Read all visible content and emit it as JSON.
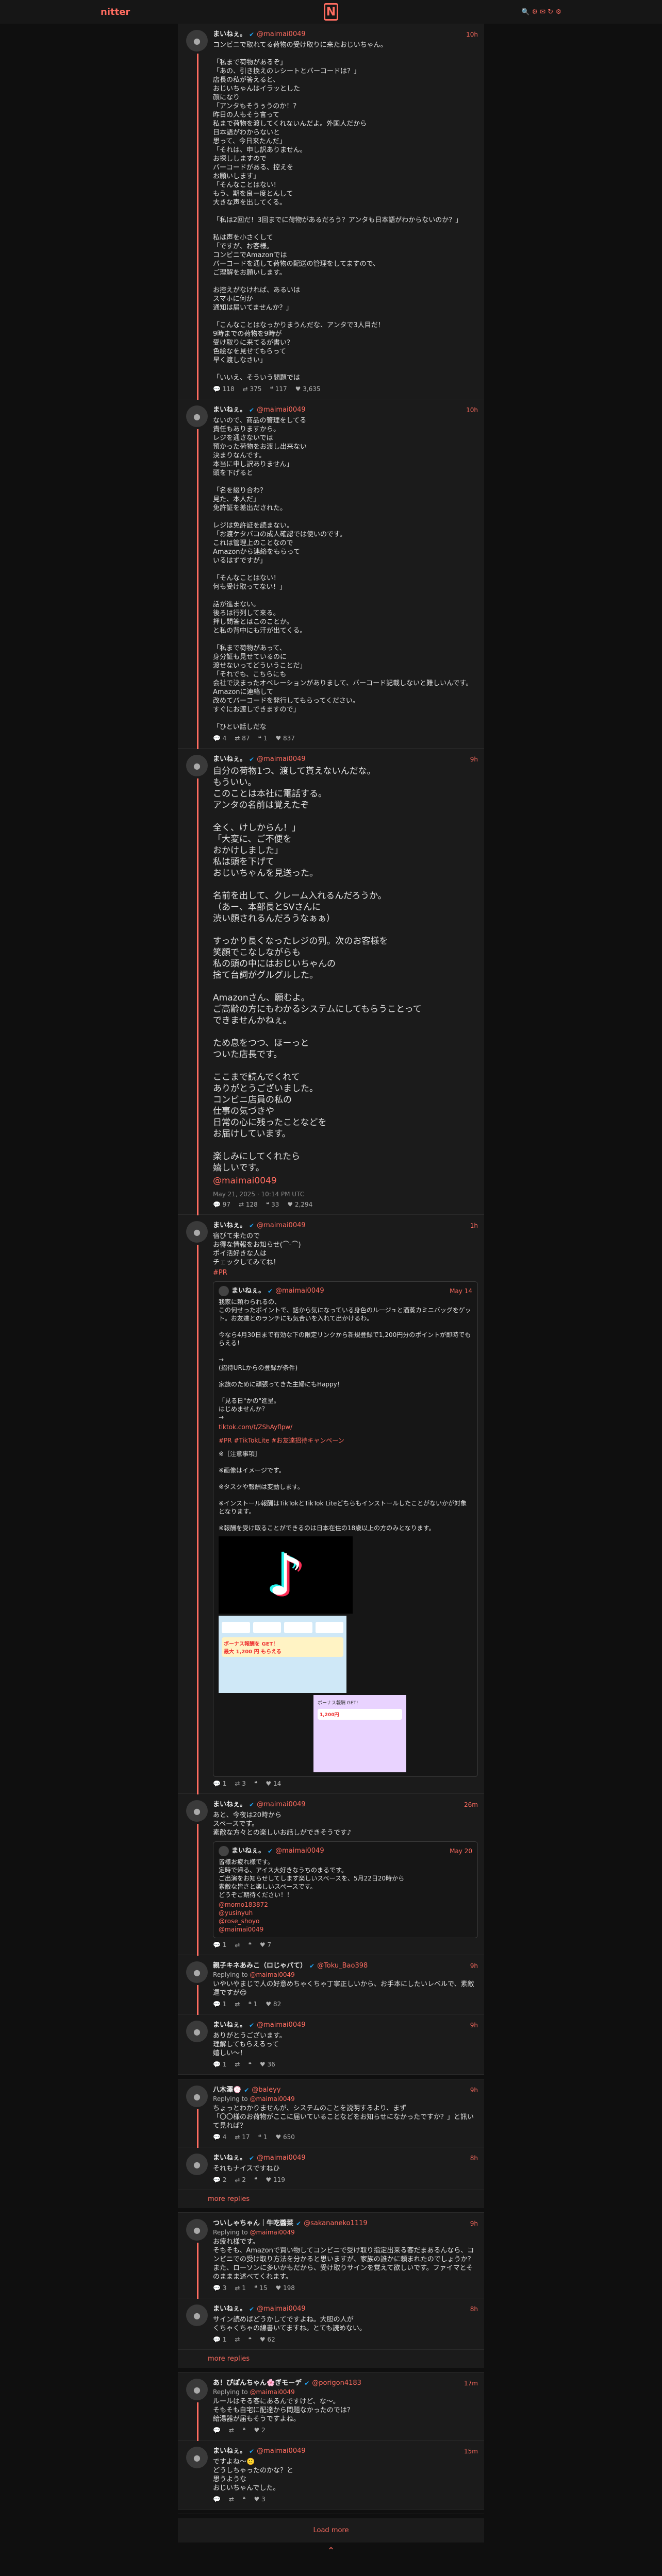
{
  "nav": {
    "brand": "nitter",
    "logo": "N",
    "icons": "🔍 ⚙ ✉ ↻ ⚙"
  },
  "thread": [
    {
      "name": "まいねぇ。",
      "handle": "@maimai0049",
      "time": "10h",
      "text": "コンビニで取れてる荷物の受け取りに来たおじいちゃん。\n\n「私まで荷物があるぞ」\n「あの、引き換えのレシートとバーコードは？」\n店長の私が答えると、\nおじいちゃんはイラッとした\n顔になり\n「アンタもそうぅうのか！？\n昨日の人もそう言って\n私まで荷物を渡してくれないんだよ。外国人だから\n日本語がわからないと\n思って、今日来たんだ」\n「それは、申し訳ありません。\nお探ししますので\nバーコードがある、控えを\nお願いします」\n「そんなことはない！\nもう、期を良ー度とんして\n大きな声を出してくる。\n\n「私は2回だ！3回までに荷物があるだろう？アンタも日本語がわからないのか？」\n\n私は声を小さくして\n「ですが、お客様。\nコンビニでAmazonでは\nバーコードを通して荷物の配送の管理をしてますので、\nご理解をお願いします。\n\nお控えがなければ、あるいは\nスマホに何か\n通知は届いてませんか？」\n\n「こんなことはなっかりまうんだな、アンタで3人目だ！\n9時までの荷物を9時が\n受け取りに来てるが書い？\n色絵なを見せてもらって\n早く渡しなさい」\n\n「いいえ、そういう問題では",
      "stats": [
        "💬 118",
        "⇄ 375",
        "❝ 117",
        "♥ 3,635"
      ]
    },
    {
      "name": "まいねぇ。",
      "handle": "@maimai0049",
      "time": "10h",
      "text": "ないので、商品の管理をしてる\n責任もありますから。\nレジを通さないでは\n預かった荷物をお渡し出来ない\n決まりなんです。\n本当に申し訳ありません」\n頭を下げると\n\n「名を綴り合わ？\n見た、本人だ」\n免許証を差出だされた。\n\nレジは免許証を読まない。\n「お渡ケタバコの成人確認では使いのです。\nこれは管理上のことなので\nAmazonから連絡をもらって\nいるはずですが」\n\n「そんなことはない！\n何も受け取ってない！」\n\n話が進まない。\n後ろは行列して来る。\n押し問答とはこのことか。\nと私の背中にも汗が出てくる。\n\n「私まで荷物があって、\n身分証も見せているのに\n渡せないってどういうことだ」\n「それでも、こちらにも\n会社で決まったオペレーションがありまして、バーコード記載しないと難しいんです。\nAmazonに連絡して\n改めてバーコードを発行してもらってください。\nすぐにお渡しできますので」\n\n「ひとい話しだな",
      "stats": [
        "💬 4",
        "⇄ 87",
        "❝ 1",
        "♥ 837"
      ]
    },
    {
      "name": "まいねぇ。",
      "handle": "@maimai0049",
      "time": "9h",
      "big": true,
      "text": "自分の荷物1つ、渡して貰えないんだな。\nもういい。\nこのことは本社に電話する。\nアンタの名前は覚えたぞ\n\n全く、けしからん！」\n「大変に、ご不便を\nおかけしました」\n私は頭を下げて\nおじいちゃんを見送った。\n\n名前を出して、クレーム入れるんだろうか。\n（あー、本部長とSVさんに\n渋い顔されるんだろうなぁぁ）\n\nすっかり長くなったレジの列。次のお客様を\n笑顔でこなしながらも\n私の頭の中にはおじいちゃんの\n捨て台詞がグルグルした。\n\nAmazonさん、願むよ。\nご高齢の方にもわかるシステムにしてもらうことって\nできませんかねぇ。\n\nため息をつつ、ほーっと\nついた店長です。\n\nここまで読んでくれて\nありがとうございました。\nコンビニ店員の私の\n仕事の気づきや\n日常の心に残ったことなどを\nお届けしています。\n\n楽しみにしてくれたら\n嬉しいです。",
      "mention": "@maimai0049",
      "date": "May 21, 2025 · 10:14 PM UTC",
      "stats": [
        "💬 97",
        "⇄ 128",
        "❝ 33",
        "♥ 2,294"
      ]
    },
    {
      "name": "まいねぇ。",
      "handle": "@maimai0049",
      "time": "1h",
      "text": "宿びて来たので\nお得な情報をお知らせ(⌒-⌒)\nポイ活好きな人は\nチェックしてみてね！",
      "tag": "#PR",
      "quote": {
        "name": "まいねぇ。",
        "handle": "@maimai0049",
        "time": "May 14",
        "text": "我家に頼わられるの、\nこの何せったポイントで、話から気になっている身色のルージュと酒蒸カミニバッグをゲット。お友達とのランチにも気合いを入れて出かけるわ。\n\n今なら4月30日まで有効な下の限定リンクから新規登録で1,200円分のポイントが即時でもらえる！\n\n→\n(招待URLからの登録が条件)\n\n家族のために頑張ってきた主婦にもHappy！\n\n「見る日\"かの\"進呈。\nはじめませんか？\n→",
        "link": "tiktok.com/t/ZShAyflpw/",
        "tags": "#PR #TikTokLite #お友達招待キャンペーン",
        "notes": "※［注意事項］\n\n※画像はイメージです。\n\n※タスクや報酬は変動します。\n\n※インストール報酬はTikTokとTikTok Liteどちらもインストールしたことがないかが対象となります。\n\n※報酬を受け取ることができるのは日本在住の18歳以上の方のみとなります。",
        "m2title": "ボーナス報酬を GET！",
        "m2sub": "最大 1,200 円 もらえる",
        "m3title": "ボーナス報酬 GET!",
        "m3card": "1,200円"
      },
      "stats": [
        "💬 1",
        "⇄ 3",
        "❝",
        "♥ 14"
      ]
    },
    {
      "name": "まいねぇ。",
      "handle": "@maimai0049",
      "time": "26m",
      "text": "あと、今夜は20時から\nスペースです。\n素敵な方々との楽しいお話しができそうです♪",
      "quote": {
        "name": "まいねぇ。",
        "handle": "@maimai0049",
        "time": "May 20",
        "text": "皆様お疲れ様です。\n定時で帰る、アイス大好きなうちのまるです。\nご出演をお知らせしてします楽しいスペースを、5月22日20時から\n素敵な皆さと楽しいスペースです。\nどうぞご期待ください！！",
        "mentions": "@momo183872\n@yusinyuh\n@rose_shoyo\n@maimai0049"
      },
      "stats": [
        "💬 1",
        "⇄",
        "❝",
        "♥ 7"
      ]
    }
  ],
  "replies": [
    {
      "items": [
        {
          "name": "親子キネあみこ（ロじゃパて）",
          "handle": "@Toku_Bao398",
          "time": "9h",
          "replying": "@maimai0049",
          "text": "いやいやまじで人の好意めちゃくちゃ丁寧正しいから、お手本にしたいレベルで、素敵運ですが😊",
          "stats": [
            "💬 1",
            "⇄",
            "❝ 1",
            "♥ 82"
          ]
        },
        {
          "name": "まいねぇ。",
          "handle": "@maimai0049",
          "time": "9h",
          "replying": "",
          "text": "ありがとうございます。\n理解してもらえるって\n嬉しい～！",
          "stats": [
            "💬 1",
            "⇄",
            "❝",
            "♥ 36"
          ]
        }
      ]
    },
    {
      "items": [
        {
          "name": "八木澤💮",
          "handle": "@baleyy",
          "time": "9h",
          "replying": "@maimai0049",
          "text": "ちょっとわかりませんが、システムのことを説明するより、まず\n「〇〇様のお荷物がここに届いていることなどをお知らせになかったですか？」と訊いて見れば？",
          "stats": [
            "💬 4",
            "⇄ 17",
            "❝ 1",
            "♥ 650"
          ]
        },
        {
          "name": "まいねぇ。",
          "handle": "@maimai0049",
          "time": "8h",
          "replying": "",
          "text": "それもナイスですねひ",
          "stats": [
            "💬 2",
            "⇄ 2",
            "❝",
            "♥ 119"
          ]
        }
      ],
      "more": "more replies"
    },
    {
      "items": [
        {
          "name": "ついしゃちゃん｜牛吃醬菜",
          "handle": "@sakananeko1119",
          "time": "9h",
          "replying": "@maimai0049",
          "text": "お疲れ様です。\nそもそも、Amazonで買い物してコンビニで受け取り指定出来る客だまあるんなら、コンビニでの受け取り方法を分かると思いますが、家族の誰かに頼まれたのでしょうか？\nまた、ローソンに多いかもだから、受け取りサインを覚えて欲しいです。ファイマとそのままま述べてくれます。",
          "stats": [
            "💬 3",
            "⇄ 1",
            "❝ 15",
            "♥ 198"
          ]
        },
        {
          "name": "まいねぇ。",
          "handle": "@maimai0049",
          "time": "8h",
          "replying": "",
          "text": "サイン読めばどうかしてですよね。大胆の人が\nくちゃくちゃの線書いてますね。とても読めない。",
          "stats": [
            "💬 1",
            "⇄",
            "❝",
            "♥ 62"
          ]
        }
      ],
      "more": "more replies"
    },
    {
      "items": [
        {
          "name": "あ！ぴぽんちゃん🌸ぎモーデ",
          "handle": "@porigon4183",
          "time": "17m",
          "replying": "@maimai0049",
          "text": "ルールはそる客にあるんですけど、な～。\nそもそも自宅に配達から問題なかったのでは？\n給湯器が届もそうですよね。",
          "stats": [
            "💬",
            "⇄",
            "❝",
            "♥ 2"
          ]
        },
        {
          "name": "まいねぇ。",
          "handle": "@maimai0049",
          "time": "15m",
          "replying": "",
          "text": "ですよね〜🙂\nどうしちゃったのかな？と\n思うような\nおじいちゃんでした。",
          "stats": [
            "💬",
            "⇄",
            "❝",
            "♥ 3"
          ]
        }
      ]
    }
  ],
  "footer": {
    "load_more": "Load more",
    "top": "⌃"
  }
}
